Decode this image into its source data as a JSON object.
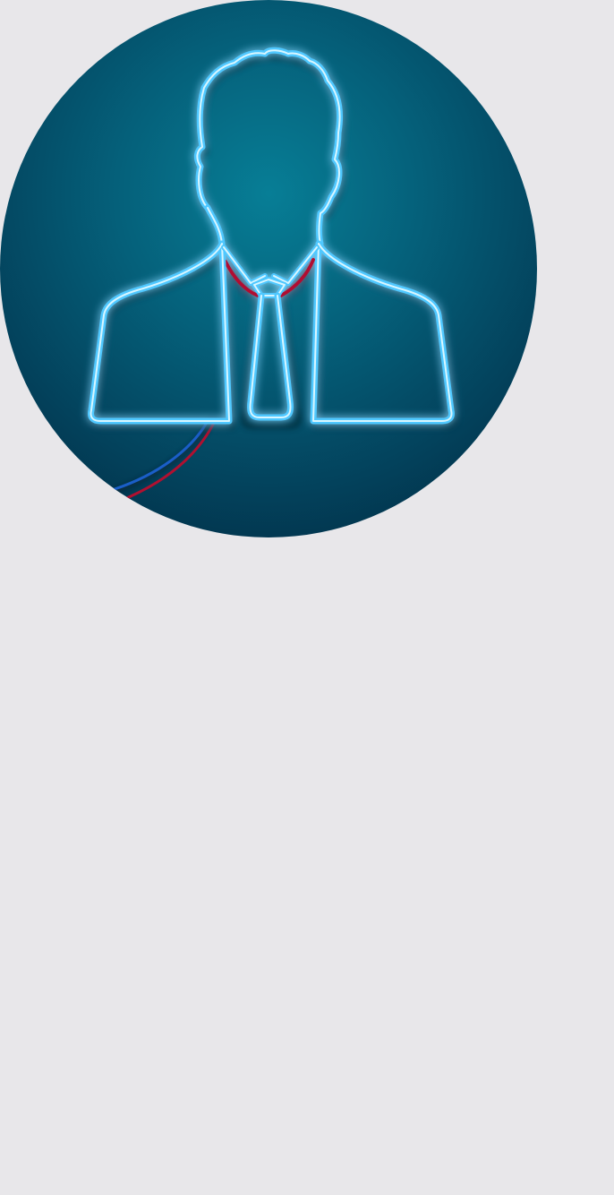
{
  "avatar": {
    "icon": "user-avatar-icon",
    "colors": {
      "background_center": "#077e96",
      "background_edge": "#01253c",
      "neon_outline": "#4fc8ff",
      "neon_core": "#d8f6ff",
      "wire_red": "#b01030",
      "wire_blue": "#1a5ec8"
    }
  },
  "page": {
    "background": "#e8e7ea"
  }
}
